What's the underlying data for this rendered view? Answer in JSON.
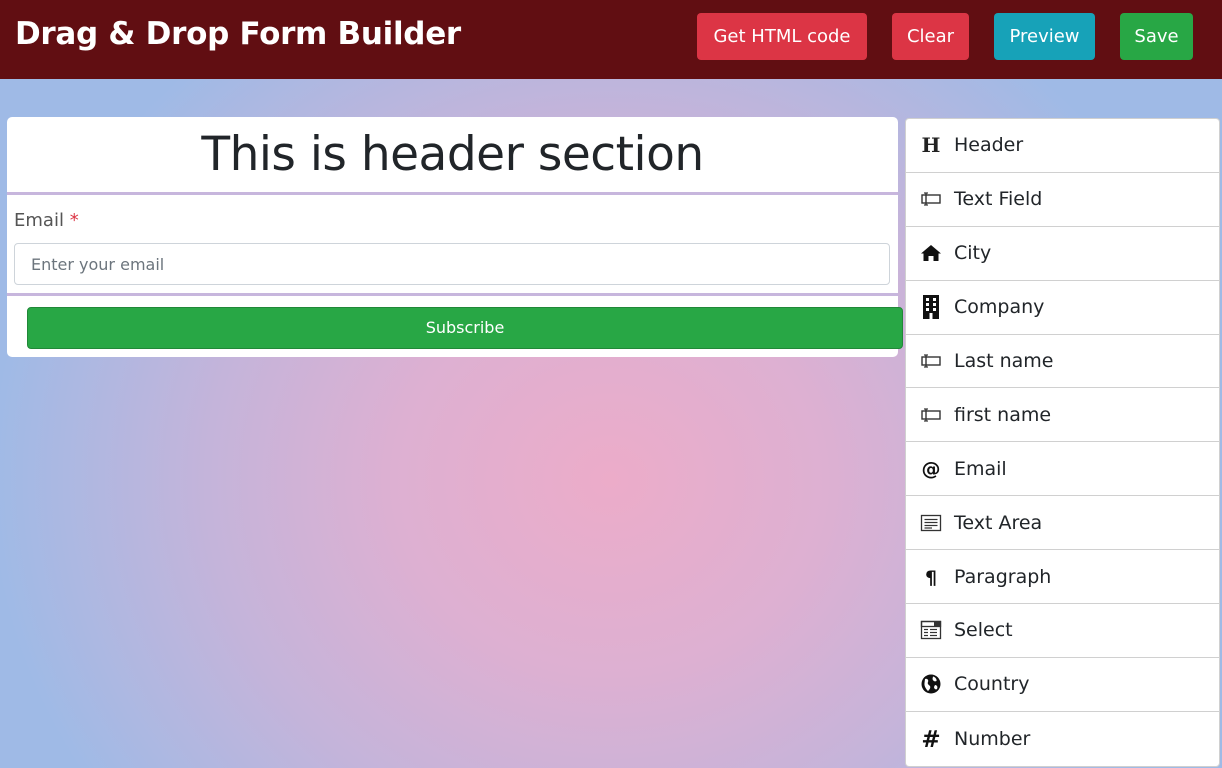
{
  "app": {
    "title": "Drag & Drop Form Builder"
  },
  "toolbar": {
    "get_html_label": "Get HTML code",
    "clear_label": "Clear",
    "preview_label": "Preview",
    "save_label": "Save"
  },
  "colors": {
    "topbar": "#610e12",
    "danger": "#dc3545",
    "info": "#17a2b8",
    "success": "#28a745"
  },
  "form": {
    "header_text": "This is header section",
    "email_label": "Email",
    "required_marker": "*",
    "email_placeholder": "Enter your email",
    "subscribe_label": "Subscribe"
  },
  "palette": {
    "items": [
      {
        "label": "Header",
        "icon": "heading-icon"
      },
      {
        "label": "Text Field",
        "icon": "text-field-icon"
      },
      {
        "label": "City",
        "icon": "home-icon"
      },
      {
        "label": "Company",
        "icon": "building-icon"
      },
      {
        "label": "Last name",
        "icon": "text-field-icon"
      },
      {
        "label": "first name",
        "icon": "text-field-icon"
      },
      {
        "label": "Email",
        "icon": "at-icon"
      },
      {
        "label": "Text Area",
        "icon": "text-area-icon"
      },
      {
        "label": "Paragraph",
        "icon": "paragraph-icon"
      },
      {
        "label": "Select",
        "icon": "select-icon"
      },
      {
        "label": "Country",
        "icon": "globe-icon"
      },
      {
        "label": "Number",
        "icon": "hash-icon"
      }
    ]
  }
}
